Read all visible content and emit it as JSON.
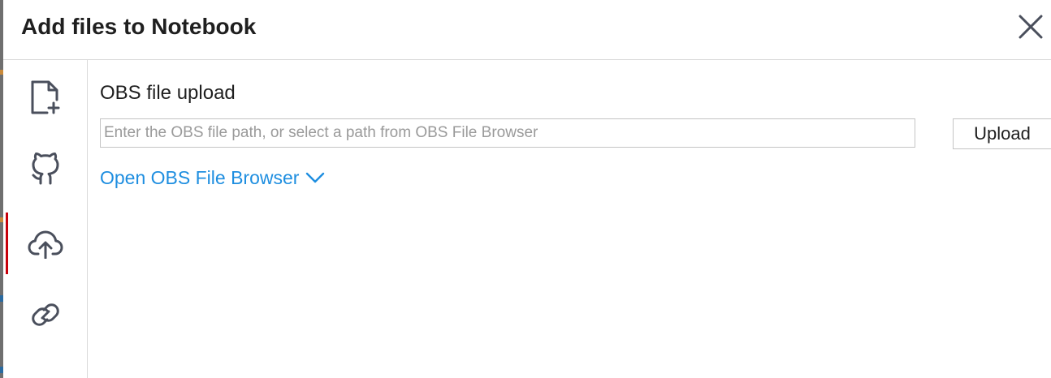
{
  "dialog": {
    "title": "Add files to Notebook",
    "close_icon": "close-icon"
  },
  "sidebar": {
    "items": [
      {
        "name": "new-file",
        "icon": "file-add-icon",
        "active": false
      },
      {
        "name": "github",
        "icon": "github-icon",
        "active": false
      },
      {
        "name": "cloud-upload",
        "icon": "cloud-upload-icon",
        "active": true
      },
      {
        "name": "link",
        "icon": "link-icon",
        "active": false
      }
    ]
  },
  "main": {
    "section_title": "OBS file upload",
    "path_input": {
      "value": "",
      "placeholder": "Enter the OBS file path, or select a path from OBS File Browser"
    },
    "upload_label": "Upload",
    "browser_link_label": "Open OBS File Browser",
    "browser_link_icon": "chevron-down-icon"
  },
  "colors": {
    "accent_link": "#1e8ee0",
    "active_indicator": "#c7000b",
    "icon": "#4a4f5c",
    "border": "#d9d9d9"
  }
}
